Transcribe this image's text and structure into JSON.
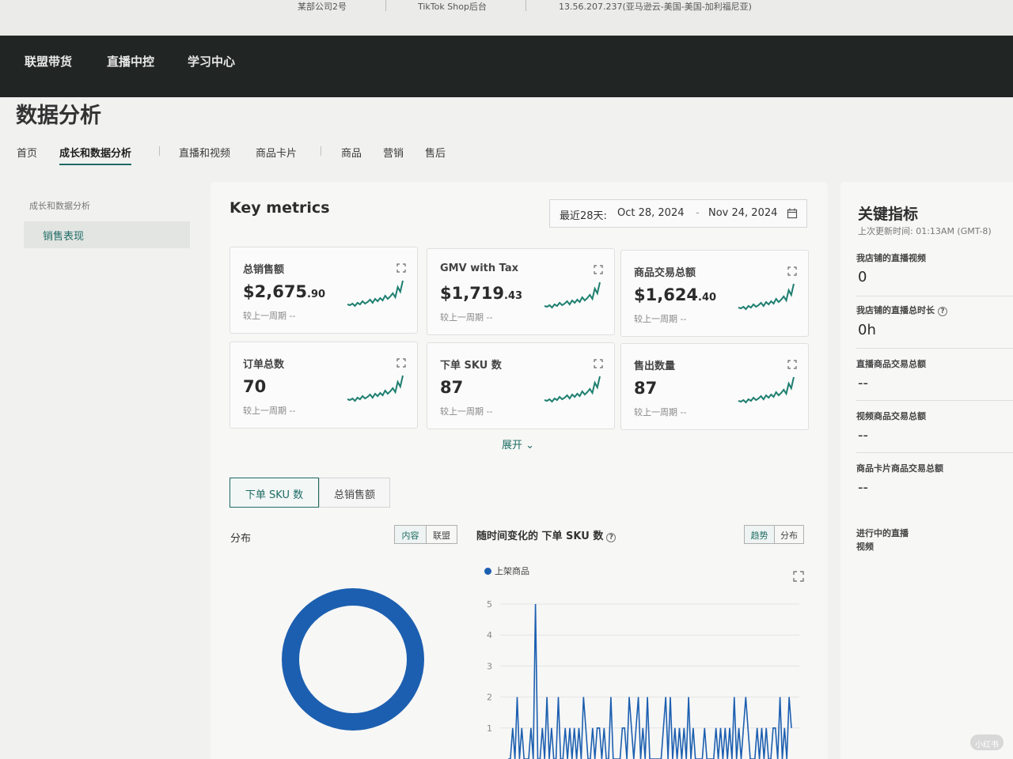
{
  "topstrip": {
    "store": "某部公司2号",
    "platform": "TikTok Shop后台",
    "ip": "13.56.207.237(亚马逊云-美国-美国-加利福尼亚)"
  },
  "nav": {
    "items": [
      {
        "label": "联盟带货"
      },
      {
        "label": "直播中控"
      },
      {
        "label": "学习中心"
      }
    ]
  },
  "page": {
    "title": "数据分析"
  },
  "tabs": [
    {
      "label": "首页"
    },
    {
      "label": "成长和数据分析"
    },
    {
      "label": "直播和视频"
    },
    {
      "label": "商品卡片"
    },
    {
      "label": "商品"
    },
    {
      "label": "营销"
    },
    {
      "label": "售后"
    }
  ],
  "sidebar": {
    "group_label": "成长和数据分析",
    "items": [
      {
        "label": "销售表现"
      }
    ]
  },
  "key_metrics": {
    "title": "Key metrics",
    "date_prefix": "最近28天:",
    "date_start": "Oct 28, 2024",
    "date_sep": "-",
    "date_end": "Nov 24, 2024",
    "cards": [
      {
        "label": "总销售额",
        "value_main": "$2,675",
        "value_cents": ".90",
        "compare": "较上一周期 --"
      },
      {
        "label": "GMV with Tax",
        "value_main": "$1,719",
        "value_cents": ".43",
        "compare": "较上一周期 --"
      },
      {
        "label": "商品交易总额",
        "value_main": "$1,624",
        "value_cents": ".40",
        "compare": "较上一周期 --"
      },
      {
        "label": "订单总数",
        "value_main": "70",
        "value_cents": "",
        "compare": "较上一周期 --"
      },
      {
        "label": "下单 SKU 数",
        "value_main": "87",
        "value_cents": "",
        "compare": "较上一周期 --"
      },
      {
        "label": "售出数量",
        "value_main": "87",
        "value_cents": "",
        "compare": "较上一周期 --"
      }
    ],
    "more_label": "展开 ⌄"
  },
  "metric_toggle": {
    "options": [
      "下单 SKU 数",
      "总销售额"
    ]
  },
  "distribution": {
    "label": "分布",
    "toggle": [
      "内容",
      "联盟"
    ]
  },
  "trend": {
    "title": "随时间变化的 下单 SKU 数",
    "toggle": [
      "趋势",
      "分布"
    ],
    "legend": "上架商品"
  },
  "colors": {
    "accent": "#1d6b63",
    "sparkline": "#1e7f70",
    "series": "#1c5fb0",
    "navbar": "#212624"
  },
  "chart_data": {
    "type": "line",
    "series": [
      {
        "name": "上架商品",
        "values": [
          0,
          0,
          1,
          0,
          2,
          0,
          1,
          0,
          0,
          0,
          1,
          0,
          5,
          0,
          0,
          1,
          0,
          2,
          0,
          1,
          0,
          0,
          2,
          0,
          0,
          1,
          0,
          1,
          0,
          1,
          0,
          1,
          0,
          2,
          1,
          0,
          0,
          1,
          0,
          1,
          1,
          0,
          1,
          0,
          0,
          2,
          0,
          0,
          0,
          0,
          1,
          1,
          0,
          2,
          1,
          0,
          1,
          2,
          0,
          1,
          0,
          2,
          0,
          0,
          0,
          0,
          0,
          0,
          1,
          2,
          0,
          2,
          0,
          1,
          0,
          1,
          0,
          1,
          0,
          2,
          0,
          1,
          0,
          0,
          0,
          0,
          1,
          0,
          0,
          0,
          0,
          1,
          0,
          1,
          0,
          1,
          0,
          1,
          0,
          2,
          0,
          1,
          0,
          1,
          2,
          1,
          0,
          0,
          0,
          1,
          0,
          1,
          0,
          1,
          0,
          0,
          1,
          1,
          0,
          2,
          0,
          1,
          0,
          2,
          1
        ]
      }
    ],
    "y_ticks": [
      "1",
      "2",
      "3",
      "4",
      "5"
    ],
    "ylim": [
      0,
      5
    ],
    "grid": true,
    "legend_position": "top-left"
  },
  "right_panel": {
    "title": "关键指标",
    "updated_label": "上次更新时间:",
    "updated_value": "01:13AM (GMT-8)",
    "items": [
      {
        "label": "我店铺的直播视频",
        "value": "0"
      },
      {
        "label": "我店铺的直播总时长",
        "value": "0h"
      },
      {
        "label": "直播商品交易总额",
        "value": "--"
      },
      {
        "label": "视频商品交易总额",
        "value": "--"
      },
      {
        "label": "商品卡片商品交易总额",
        "value": "--"
      },
      {
        "label": "进行中的直播视频",
        "value": ""
      }
    ]
  },
  "watermark": "小红书"
}
